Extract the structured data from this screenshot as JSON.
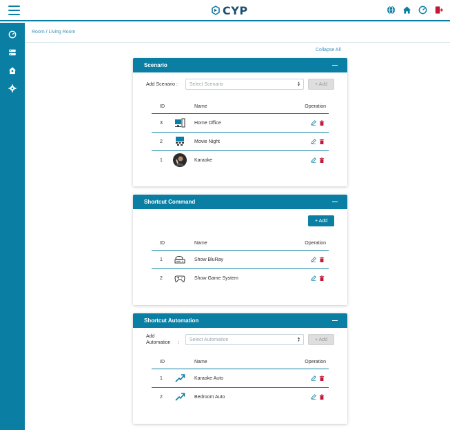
{
  "header": {
    "logo_text": "CYP",
    "icons": [
      "globe-icon",
      "home-icon",
      "dashboard-icon",
      "logout-icon"
    ]
  },
  "sidebar": {
    "items": [
      "dashboard-icon",
      "server-icon",
      "room-icon",
      "settings-icon"
    ]
  },
  "breadcrumb": "Room / Living Room",
  "collapse_all": "Collapse All",
  "colors": {
    "accent": "#0a7fa3",
    "delete": "#c0193a",
    "logo": "#1c4f6e"
  },
  "scenario": {
    "title": "Scenario",
    "add_label": "Add Scenario :",
    "select_placeholder": "Select Scenario",
    "add_button": "+ Add",
    "columns": {
      "id": "ID",
      "name": "Name",
      "operation": "Operation"
    },
    "rows": [
      {
        "id": "3",
        "name": "Home Office",
        "icon": "office-icon"
      },
      {
        "id": "2",
        "name": "Movie Night",
        "icon": "cinema-icon"
      },
      {
        "id": "1",
        "name": "Karaoke",
        "icon": "karaoke-photo"
      }
    ]
  },
  "shortcut_command": {
    "title": "Shortcut Command",
    "add_button": "+ Add",
    "columns": {
      "id": "ID",
      "name": "Name",
      "operation": "Operation"
    },
    "rows": [
      {
        "id": "1",
        "name": "Show BluRay",
        "icon": "bluray-player-icon"
      },
      {
        "id": "2",
        "name": "Show Game System",
        "icon": "gamepad-icon"
      }
    ]
  },
  "shortcut_automation": {
    "title": "Shortcut Automation",
    "add_label_line1": "Add",
    "add_label_line2": "Automation",
    "add_label_colon": ":",
    "select_placeholder": "Select Automation",
    "add_button": "+ Add",
    "columns": {
      "id": "ID",
      "name": "Name",
      "operation": "Operation"
    },
    "rows": [
      {
        "id": "1",
        "name": "Karaoke Auto",
        "icon": "trend-arrow-icon"
      },
      {
        "id": "2",
        "name": "Bedroom Auto",
        "icon": "trend-arrow-icon"
      }
    ]
  }
}
